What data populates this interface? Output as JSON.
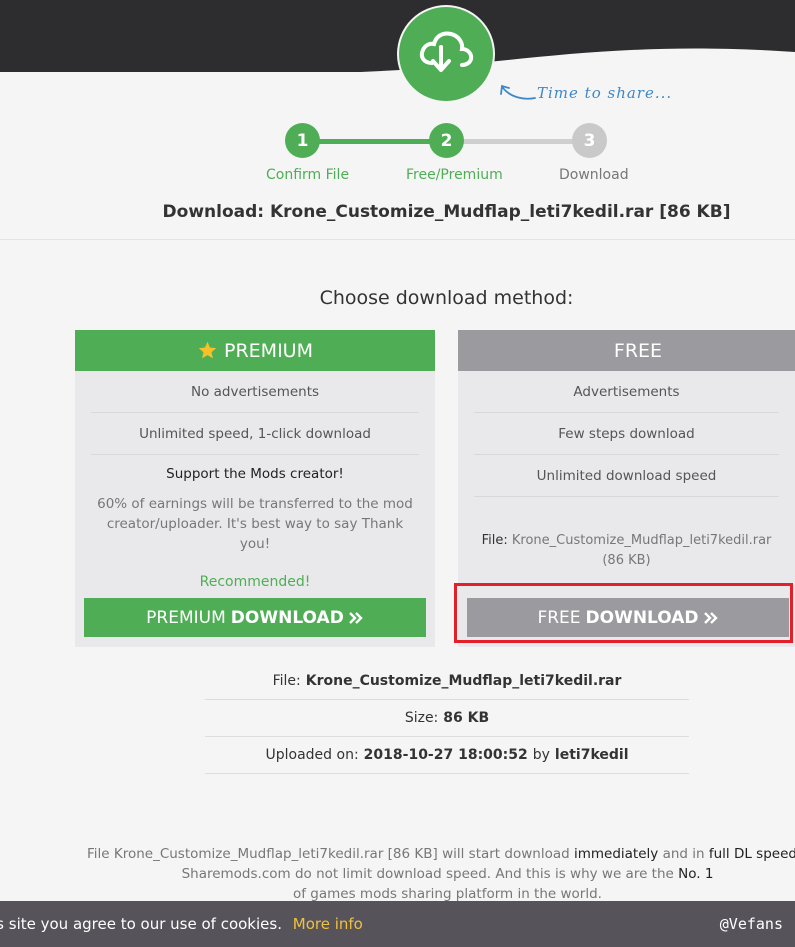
{
  "header": {
    "tagline": "Time to share...",
    "logo_icon": "cloud-download-icon",
    "brand_color": "#4fae55"
  },
  "steps": [
    {
      "number": "1",
      "label": "Confirm File",
      "status": "done"
    },
    {
      "number": "2",
      "label": "Free/Premium",
      "status": "active"
    },
    {
      "number": "3",
      "label": "Download",
      "status": "pending"
    }
  ],
  "download_title": "Download: Krone_Customize_Mudflap_leti7kedil.rar [86 KB]",
  "choose_label": "Choose download method:",
  "premium": {
    "title": "PREMIUM",
    "icon": "star-icon",
    "features": [
      "No advertisements",
      "Unlimited speed, 1-click download"
    ],
    "support_title": "Support the Mods creator!",
    "support_desc": "60% of earnings will be transferred to the mod creator/uploader. It's best way to say Thank you!",
    "recommended": "Recommended!",
    "button_prefix": "PREMIUM",
    "button_bold": "DOWNLOAD",
    "button_icon": "double-chevron-right-icon"
  },
  "free": {
    "title": "FREE",
    "features": [
      "Advertisements",
      "Few steps download",
      "Unlimited download speed"
    ],
    "file_label": "File:",
    "file_value": "Krone_Customize_Mudflap_leti7kedil.rar (86 KB)",
    "button_prefix": "FREE",
    "button_bold": "DOWNLOAD",
    "button_icon": "double-chevron-right-icon"
  },
  "meta": {
    "file_label": "File:",
    "file_value": "Krone_Customize_Mudflap_leti7kedil.rar",
    "size_label": "Size:",
    "size_value": "86 KB",
    "uploaded_label": "Uploaded on:",
    "uploaded_value": "2018-10-27 18:00:52",
    "by_label": "by",
    "uploader": "leti7kedil"
  },
  "footer_note": {
    "part1": "File Krone_Customize_Mudflap_leti7kedil.rar [86 KB] will start download",
    "immediately": "immediately",
    "part2": "and in",
    "full_speed": "full DL speed",
    "part3": "*. Sharemods.com do not limit download speed. And this is why we are the",
    "no1": "No. 1",
    "part4": "of games mods sharing platform in the world."
  },
  "cookie_bar": {
    "text": "is site you agree to our use of cookies.",
    "link": "More info",
    "watermark": "@Vefans"
  }
}
